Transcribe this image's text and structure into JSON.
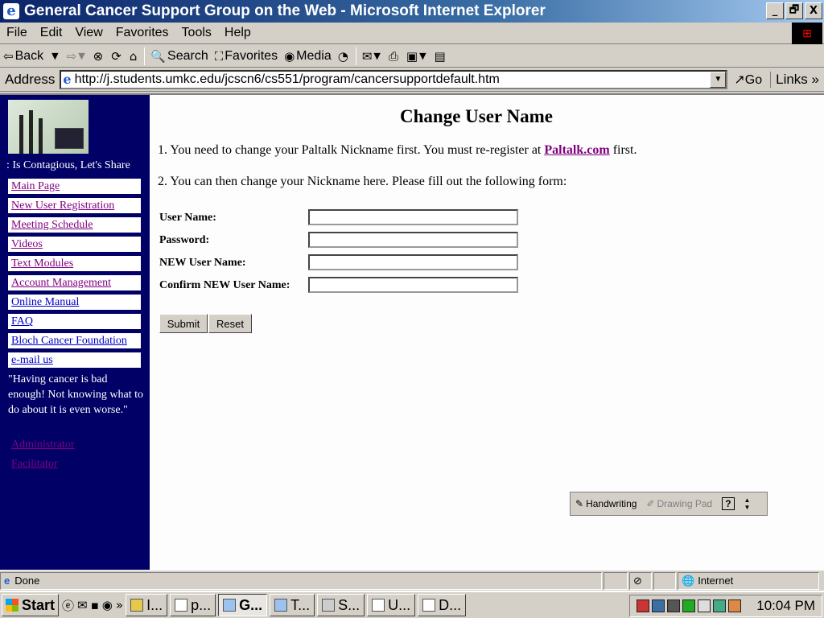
{
  "window": {
    "title": "General Cancer Support Group on the Web - Microsoft Internet Explorer",
    "min": "_",
    "restore": "🗗",
    "close": "X"
  },
  "menu": [
    "File",
    "Edit",
    "View",
    "Favorites",
    "Tools",
    "Help"
  ],
  "toolbar": {
    "back": "Back",
    "search": "Search",
    "favorites": "Favorites",
    "media": "Media"
  },
  "address": {
    "label": "Address",
    "url": "http://j.students.umkc.edu/jcscn6/cs551/program/cancersupportdefault.htm",
    "go": "Go",
    "links": "Links"
  },
  "sidebar": {
    "marquee": ": Is Contagious, Let's Share",
    "nav": [
      {
        "label": "Main Page",
        "color": "purple"
      },
      {
        "label": "New User Registration",
        "color": "purple"
      },
      {
        "label": "Meeting Schedule",
        "color": "purple"
      },
      {
        "label": "Videos",
        "color": "purple"
      },
      {
        "label": "Text Modules",
        "color": "purple"
      },
      {
        "label": "Account Management",
        "color": "purple"
      },
      {
        "label": "Online Manual",
        "color": "blue"
      },
      {
        "label": "FAQ",
        "color": "blue"
      },
      {
        "label": "Bloch Cancer Foundation",
        "color": "blue"
      },
      {
        "label": "e-mail us",
        "color": "blue"
      }
    ],
    "quote": "\"Having cancer is bad enough! Not knowing what to do about it is even worse.\"",
    "admin": "Administrator",
    "facilitator": "Facilitator"
  },
  "main": {
    "heading": "Change User Name",
    "step1_prefix": "1. You need to change your Paltalk Nickname first.  You must re-register at ",
    "step1_link": "Paltalk.com",
    "step1_suffix": " first.",
    "step2": "2. You can then change your Nickname here.  Please fill out the following form:",
    "form": {
      "username_label": "User Name:",
      "password_label": "Password:",
      "new_username_label": "NEW User Name:",
      "confirm_label": "Confirm NEW User Name:",
      "username_value": "",
      "password_value": "",
      "new_username_value": "",
      "confirm_value": "",
      "submit": "Submit",
      "reset": "Reset"
    }
  },
  "langbar": {
    "handwriting": "Handwriting",
    "drawing_pad": "Drawing Pad",
    "help": "?"
  },
  "status": {
    "text": "Done",
    "zone": "Internet"
  },
  "taskbar": {
    "start": "Start",
    "tasks": [
      "I...",
      "p...",
      "G...",
      "T...",
      "S...",
      "U...",
      "D..."
    ],
    "clock": "10:04 PM"
  },
  "colors": {
    "sidebar_bg": "#000066",
    "titlebar": "#0a246a",
    "visited_link": "#800080",
    "link": "#0000cc"
  }
}
